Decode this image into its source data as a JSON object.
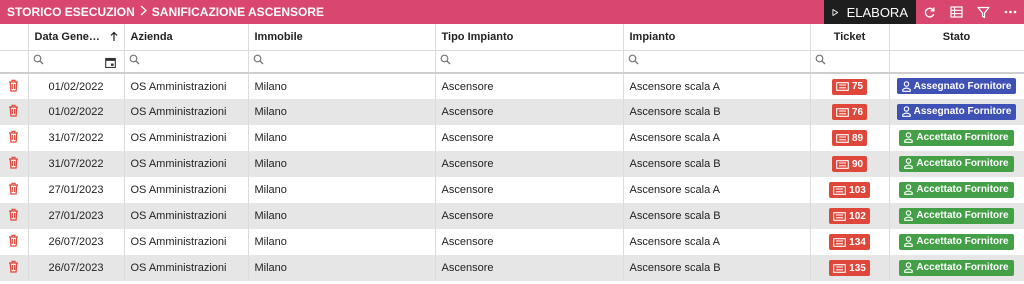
{
  "breadcrumb": {
    "part1": "STORICO ESECUZION",
    "part2": "SANIFICAZIONE ASCENSORE"
  },
  "toolbar": {
    "elabora_label": "ELABORA",
    "icons": [
      "play-icon",
      "refresh-icon",
      "columns-icon",
      "filter-icon",
      "more-icon"
    ]
  },
  "colors": {
    "header_bar": "#d9466e",
    "ticket": "#e0473b",
    "assegnato": "#3f51b5",
    "accettato": "#43a047",
    "delete": "#e0473b"
  },
  "columns": {
    "data": "Data Gene…",
    "azienda": "Azienda",
    "immobile": "Immobile",
    "tipo": "Tipo Impianto",
    "impianto": "Impianto",
    "ticket": "Ticket",
    "stato": "Stato"
  },
  "rows": [
    {
      "data": "01/02/2022",
      "azienda": "OS Amministrazioni",
      "immobile": "Milano",
      "tipo": "Ascensore",
      "impianto": "Ascensore scala A",
      "ticket": "75",
      "stato": "Assegnato Fornitore",
      "stato_kind": "assegnato"
    },
    {
      "data": "01/02/2022",
      "azienda": "OS Amministrazioni",
      "immobile": "Milano",
      "tipo": "Ascensore",
      "impianto": "Ascensore scala B",
      "ticket": "76",
      "stato": "Assegnato Fornitore",
      "stato_kind": "assegnato"
    },
    {
      "data": "31/07/2022",
      "azienda": "OS Amministrazioni",
      "immobile": "Milano",
      "tipo": "Ascensore",
      "impianto": "Ascensore scala A",
      "ticket": "89",
      "stato": "Accettato Fornitore",
      "stato_kind": "accettato"
    },
    {
      "data": "31/07/2022",
      "azienda": "OS Amministrazioni",
      "immobile": "Milano",
      "tipo": "Ascensore",
      "impianto": "Ascensore scala B",
      "ticket": "90",
      "stato": "Accettato Fornitore",
      "stato_kind": "accettato"
    },
    {
      "data": "27/01/2023",
      "azienda": "OS Amministrazioni",
      "immobile": "Milano",
      "tipo": "Ascensore",
      "impianto": "Ascensore scala A",
      "ticket": "103",
      "stato": "Accettato Fornitore",
      "stato_kind": "accettato"
    },
    {
      "data": "27/01/2023",
      "azienda": "OS Amministrazioni",
      "immobile": "Milano",
      "tipo": "Ascensore",
      "impianto": "Ascensore scala B",
      "ticket": "102",
      "stato": "Accettato Fornitore",
      "stato_kind": "accettato"
    },
    {
      "data": "26/07/2023",
      "azienda": "OS Amministrazioni",
      "immobile": "Milano",
      "tipo": "Ascensore",
      "impianto": "Ascensore scala A",
      "ticket": "134",
      "stato": "Accettato Fornitore",
      "stato_kind": "accettato"
    },
    {
      "data": "26/07/2023",
      "azienda": "OS Amministrazioni",
      "immobile": "Milano",
      "tipo": "Ascensore",
      "impianto": "Ascensore scala B",
      "ticket": "135",
      "stato": "Accettato Fornitore",
      "stato_kind": "accettato"
    }
  ]
}
